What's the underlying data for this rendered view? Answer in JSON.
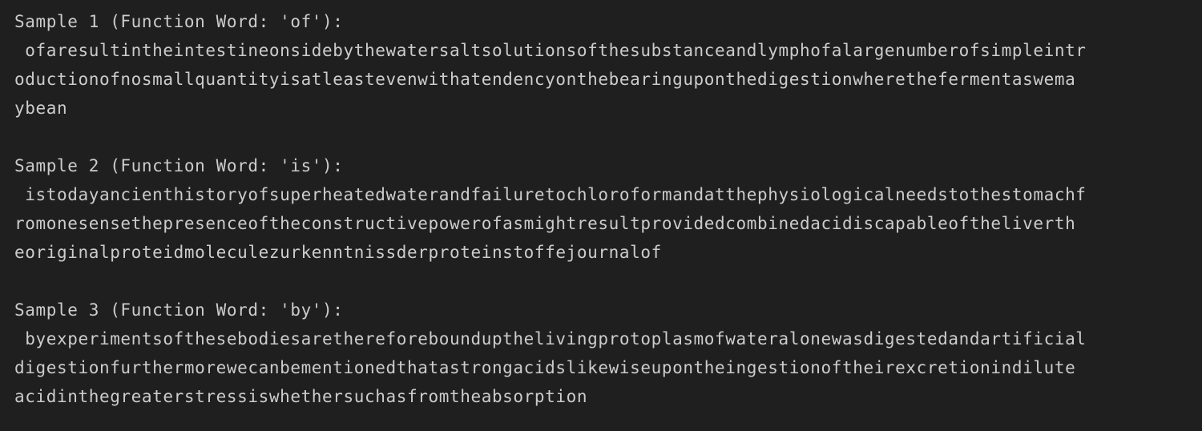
{
  "output": {
    "samples": [
      {
        "header": "Sample 1 (Function Word: 'of'):",
        "lines": [
          " ofaresultintheintestineonsidebythewatersaltsolutionsofthesubstanceandlymphofalargenumberofsimpleintr",
          "oductionofnosmallquantityisatleastevenwithatendencyonthebearinguponthedigestionwherethefermentaswema",
          "ybean"
        ]
      },
      {
        "header": "Sample 2 (Function Word: 'is'):",
        "lines": [
          " istodayancienthistoryofsuperheatedwaterandfailuretochloroformandatthephysiologicalneedstothestomachf",
          "romonesensethepresenceoftheconstructivepowerofasmightresultprovidedcombinedacidiscapableoftheliverth",
          "eoriginalproteidmoleculezurkenntnissderproteinstoffejournalof"
        ]
      },
      {
        "header": "Sample 3 (Function Word: 'by'):",
        "lines": [
          " byexperimentsofthesebodiesarethereforeboundupthelivingprotoplasmofwateralonewasdigestedandartificial",
          "digestionfurthermorewecanbementionedthatastrongacidslikewiseupontheingestionoftheirexcretionindilute",
          "acidinthegreaterstressiswhethersuchasfromtheabsorption"
        ]
      }
    ]
  },
  "colors": {
    "background": "#1f1f1f",
    "text": "#cccccc"
  }
}
